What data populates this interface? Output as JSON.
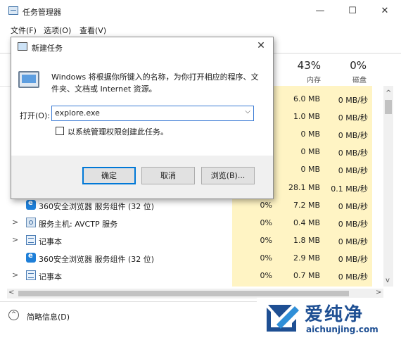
{
  "task_manager": {
    "title": "任务管理器",
    "window_buttons": {
      "minimize": "—",
      "maximize": "☐",
      "close": "✕"
    },
    "menu": [
      "文件(F)",
      "选项(O)",
      "查看(V)"
    ],
    "columns": [
      {
        "pct": "43%",
        "label": "内存"
      },
      {
        "pct": "0%",
        "label": "磁盘"
      }
    ],
    "hidden_rows": [
      {
        "memory": "6.0 MB",
        "disk": "0 MB/秒"
      },
      {
        "memory": "1.0 MB",
        "disk": "0 MB/秒"
      },
      {
        "memory": "0 MB",
        "disk": "0 MB/秒"
      },
      {
        "memory": "0 MB",
        "disk": "0 MB/秒"
      },
      {
        "memory": "0 MB",
        "disk": "0 MB/秒"
      },
      {
        "memory": "28.1 MB",
        "disk": "0.1 MB/秒"
      }
    ],
    "rows": [
      {
        "expand": "",
        "icon": "browser-360-icon",
        "name": "360安全浏览器 服务组件 (32 位)",
        "cpu": "0%",
        "memory": "7.2 MB",
        "disk": "0 MB/秒"
      },
      {
        "expand": ">",
        "icon": "service-host-icon",
        "name": "服务主机: AVCTP 服务",
        "cpu": "0%",
        "memory": "0.4 MB",
        "disk": "0 MB/秒"
      },
      {
        "expand": ">",
        "icon": "notepad-icon",
        "name": "记事本",
        "cpu": "0%",
        "memory": "1.8 MB",
        "disk": "0 MB/秒"
      },
      {
        "expand": "",
        "icon": "browser-360-icon",
        "name": "360安全浏览器 服务组件 (32 位)",
        "cpu": "0%",
        "memory": "2.9 MB",
        "disk": "0 MB/秒"
      },
      {
        "expand": ">",
        "icon": "notepad-icon",
        "name": "记事本",
        "cpu": "0%",
        "memory": "0.7 MB",
        "disk": "0 MB/秒"
      }
    ],
    "scroll": {
      "up": "^",
      "down": "v",
      "left": "<",
      "right": ">"
    },
    "fewer_details": "简略信息(D)"
  },
  "run_dialog": {
    "title": "新建任务",
    "close": "✕",
    "description": "Windows 将根据你所键入的名称，为你打开相应的程序、文件夹、文档或 Internet 资源。",
    "open_label": "打开(O):",
    "input_value": "explore.exe",
    "checkbox_label": "以系统管理权限创建此任务。",
    "buttons": {
      "ok": "确定",
      "cancel": "取消",
      "browse": "浏览(B)..."
    }
  },
  "watermark": {
    "text": "爱纯净",
    "url": "aichunjing.com"
  }
}
